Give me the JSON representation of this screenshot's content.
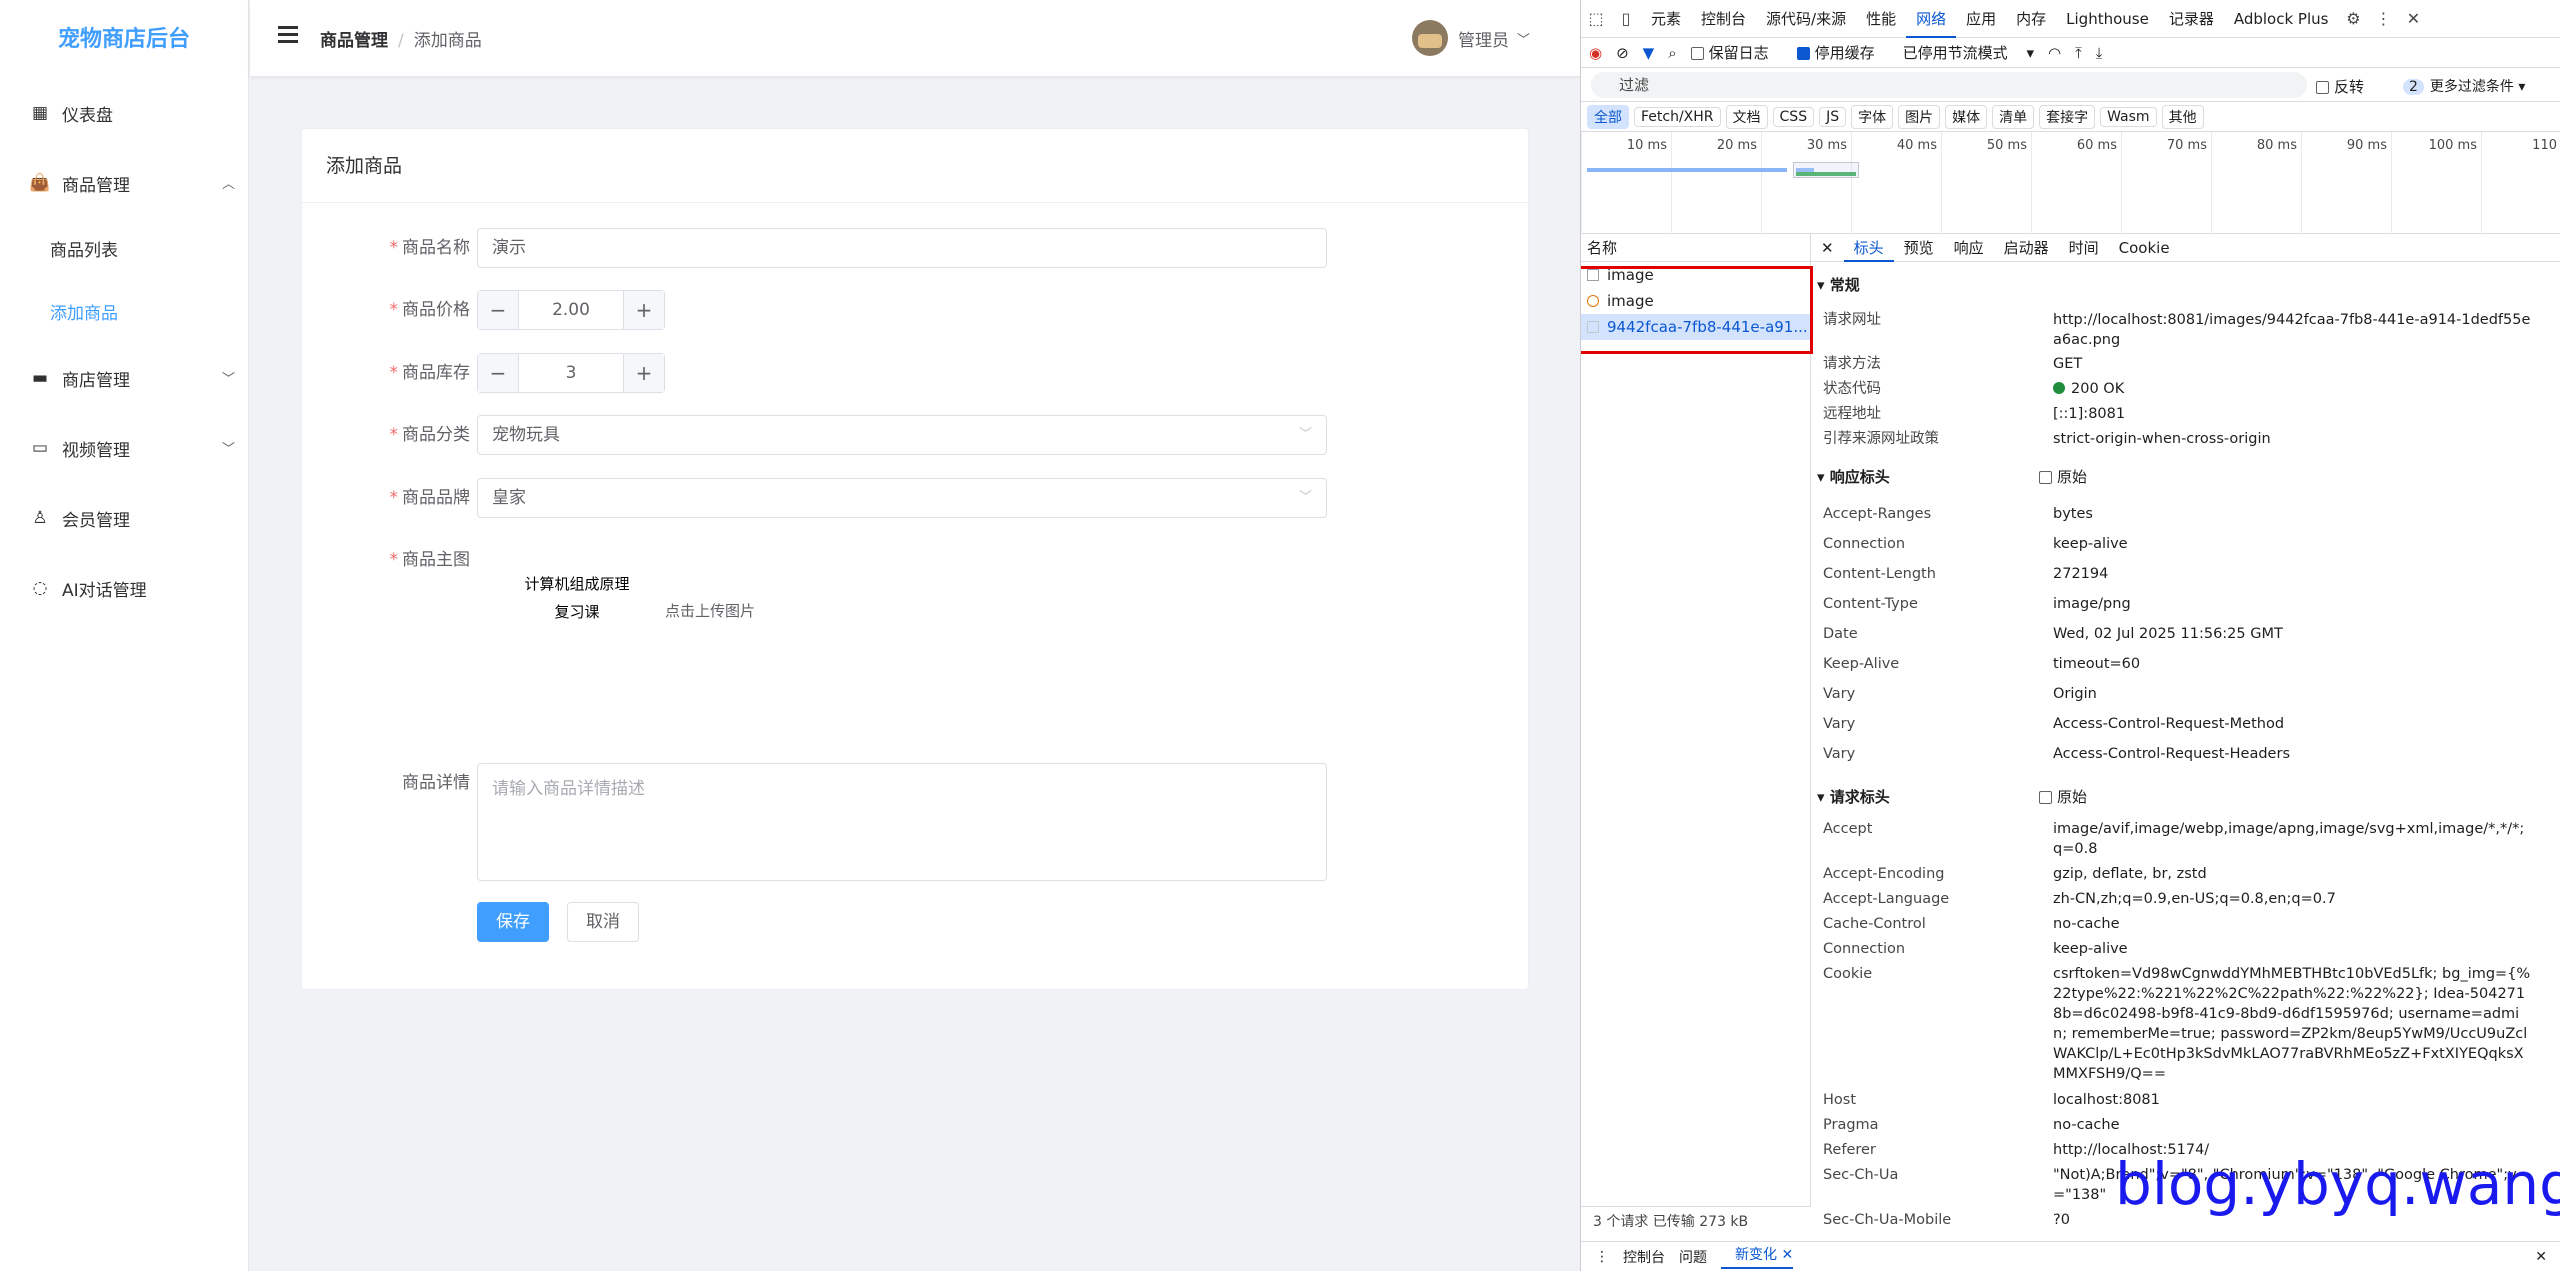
{
  "sidebar": {
    "logo": "宠物商店后台",
    "items": [
      {
        "label": "仪表盘",
        "icon": "dashboard-icon"
      },
      {
        "label": "商品管理",
        "icon": "shopping-bag-icon"
      },
      {
        "label": "商品列表"
      },
      {
        "label": "添加商品"
      },
      {
        "label": "商店管理",
        "icon": "wallet-icon"
      },
      {
        "label": "视频管理",
        "icon": "video-icon"
      },
      {
        "label": "会员管理",
        "icon": "user-icon"
      },
      {
        "label": "AI对话管理",
        "icon": "chat-icon"
      }
    ]
  },
  "header": {
    "breadcrumb_parent": "商品管理",
    "breadcrumb_sep": "/",
    "breadcrumb_current": "添加商品",
    "user": "管理员"
  },
  "form": {
    "title": "添加商品",
    "name_label": "商品名称",
    "name_value": "演示",
    "price_label": "商品价格",
    "price_value": "2.00",
    "stock_label": "商品库存",
    "stock_value": "3",
    "category_label": "商品分类",
    "category_value": "宠物玩具",
    "brand_label": "商品品牌",
    "brand_value": "皇家",
    "image_label": "商品主图",
    "image_line1": "计算机组成原理",
    "image_line2": "复习课",
    "upload_hint": "点击上传图片",
    "detail_label": "商品详情",
    "detail_placeholder": "请输入商品详情描述",
    "save": "保存",
    "cancel": "取消"
  },
  "devtools": {
    "tabs": [
      "元素",
      "控制台",
      "源代码/来源",
      "性能",
      "网络",
      "应用",
      "内存",
      "Lighthouse",
      "记录器",
      "Adblock Plus"
    ],
    "active_tab": "网络",
    "preserve_log": "保留日志",
    "disable_cache": "停用缓存",
    "throttle": "已停用节流模式",
    "filter_placeholder": "过滤",
    "invert": "反转",
    "more_filters_count": "2",
    "more_filters": "更多过滤条件",
    "types": [
      "全部",
      "Fetch/XHR",
      "文档",
      "CSS",
      "JS",
      "字体",
      "图片",
      "媒体",
      "清单",
      "套接字",
      "Wasm",
      "其他"
    ],
    "ticks": [
      "10 ms",
      "20 ms",
      "30 ms",
      "40 ms",
      "50 ms",
      "60 ms",
      "70 ms",
      "80 ms",
      "90 ms",
      "100 ms",
      "110"
    ],
    "name_header": "名称",
    "requests": [
      "image",
      "image",
      "9442fcaa-7fb8-441e-a91..."
    ],
    "detail_tabs": [
      "标头",
      "预览",
      "响应",
      "启动器",
      "时间",
      "Cookie"
    ],
    "general_title": "常规",
    "general": [
      {
        "k": "请求网址",
        "v": "http://localhost:8081/images/9442fcaa-7fb8-441e-a914-1dedf55ea6ac.png"
      },
      {
        "k": "请求方法",
        "v": "GET"
      },
      {
        "k": "状态代码",
        "v": "200 OK"
      },
      {
        "k": "远程地址",
        "v": "[::1]:8081"
      },
      {
        "k": "引荐来源网址政策",
        "v": "strict-origin-when-cross-origin"
      }
    ],
    "resp_title": "响应标头",
    "raw": "原始",
    "response_headers": [
      {
        "k": "Accept-Ranges",
        "v": "bytes"
      },
      {
        "k": "Connection",
        "v": "keep-alive"
      },
      {
        "k": "Content-Length",
        "v": "272194"
      },
      {
        "k": "Content-Type",
        "v": "image/png"
      },
      {
        "k": "Date",
        "v": "Wed, 02 Jul 2025 11:56:25 GMT"
      },
      {
        "k": "Keep-Alive",
        "v": "timeout=60"
      },
      {
        "k": "Vary",
        "v": "Origin"
      },
      {
        "k": "Vary",
        "v": "Access-Control-Request-Method"
      },
      {
        "k": "Vary",
        "v": "Access-Control-Request-Headers"
      }
    ],
    "req_title": "请求标头",
    "request_headers": [
      {
        "k": "Accept",
        "v": "image/avif,image/webp,image/apng,image/svg+xml,image/*,*/*;q=0.8"
      },
      {
        "k": "Accept-Encoding",
        "v": "gzip, deflate, br, zstd"
      },
      {
        "k": "Accept-Language",
        "v": "zh-CN,zh;q=0.9,en-US;q=0.8,en;q=0.7"
      },
      {
        "k": "Cache-Control",
        "v": "no-cache"
      },
      {
        "k": "Connection",
        "v": "keep-alive"
      },
      {
        "k": "Cookie",
        "v": "csrftoken=Vd98wCgnwddYMhMEBTHBtc10bVEd5Lfk; bg_img={%22type%22:%221%22%2C%22path%22:%22%22}; Idea-5042718b=d6c02498-b9f8-41c9-8bd9-d6df1595976d; username=admin; rememberMe=true; password=ZP2km/8eup5YwM9/UccU9uZclWAKClp/L+Ec0tHp3kSdvMkLAO77raBVRhMEo5zZ+FxtXIYEQqksXMMXFSH9/Q=="
      },
      {
        "k": "Host",
        "v": "localhost:8081"
      },
      {
        "k": "Pragma",
        "v": "no-cache"
      },
      {
        "k": "Referer",
        "v": "http://localhost:5174/"
      },
      {
        "k": "Sec-Ch-Ua",
        "v": "\"Not)A;Brand\";v=\"8\", \"Chromium\";v=\"138\", \"Google Chrome\";v=\"138\""
      },
      {
        "k": "Sec-Ch-Ua-Mobile",
        "v": "?0"
      }
    ],
    "status": "3 个请求   已传输 273 kB",
    "drawer_tabs": [
      "控制台",
      "问题",
      "新变化"
    ]
  },
  "watermark": "blog.ybyq.wang"
}
